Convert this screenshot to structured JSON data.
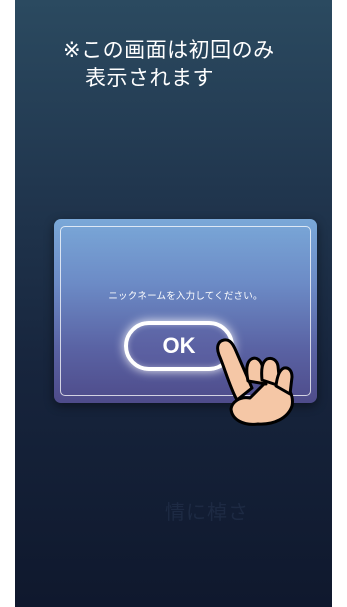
{
  "notice": {
    "line1": "※この画面は初回のみ",
    "line2": "表示されます"
  },
  "background_text": "情に棹さ",
  "dialog": {
    "message": "ニックネームを入力してください。",
    "ok_label": "OK"
  },
  "icons": {
    "hand": "tapping-hand-icon"
  },
  "colors": {
    "background_top": "#2b4a60",
    "background_bottom": "#0f182d",
    "dialog_top": "#7aa8d8",
    "dialog_bottom": "#4e4b8a",
    "hand_fill": "#f5c7a6",
    "hand_outline": "#000000"
  }
}
